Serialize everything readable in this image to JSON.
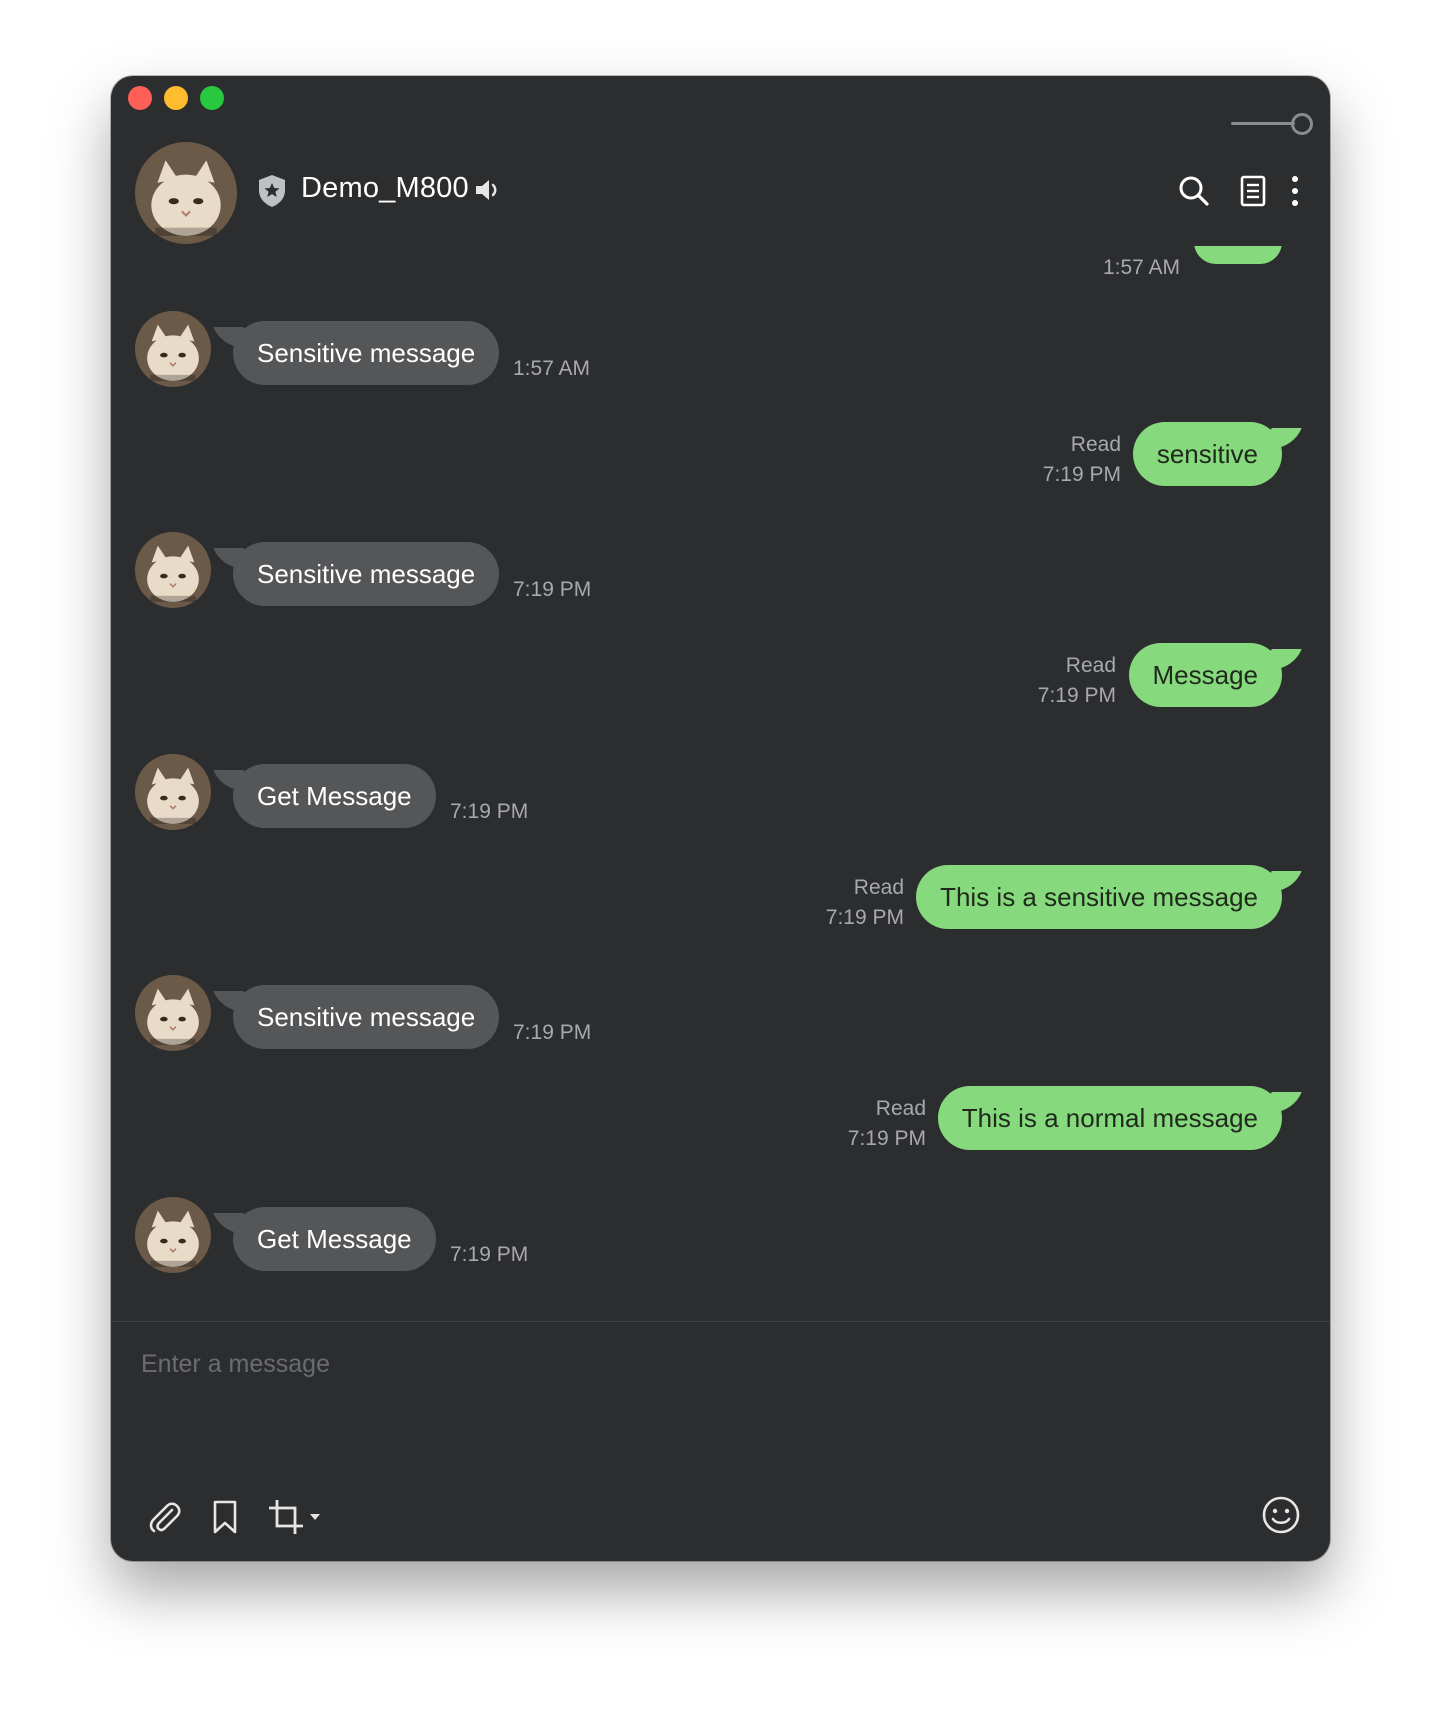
{
  "window": {
    "title": "Demo_M800",
    "traffic_lights": [
      "close",
      "minimize",
      "maximize"
    ],
    "colors": {
      "background": "#2c2d2f",
      "incoming_bubble": "#555658",
      "outgoing_bubble": "#86d97c",
      "meta_text": "#a8a9ab"
    }
  },
  "header": {
    "avatar_icon": "cat-avatar",
    "badge_icon": "shield-star-icon",
    "contact_name": "Demo_M800",
    "sound_icon": "speaker-icon",
    "actions": [
      "search-icon",
      "notes-icon",
      "more-icon"
    ],
    "slider_icon": "slider-toggle"
  },
  "messages": {
    "partial_top": {
      "time": "1:57 AM"
    },
    "items": [
      {
        "direction": "in",
        "text": "Sensitive message",
        "time": "1:57 AM"
      },
      {
        "direction": "out",
        "text": "sensitive",
        "status": "Read",
        "time": "7:19 PM"
      },
      {
        "direction": "in",
        "text": "Sensitive message",
        "time": "7:19 PM"
      },
      {
        "direction": "out",
        "text": "Message",
        "status": "Read",
        "time": "7:19 PM"
      },
      {
        "direction": "in",
        "text": "Get Message",
        "time": "7:19 PM"
      },
      {
        "direction": "out",
        "text": "This is a sensitive message",
        "status": "Read",
        "time": "7:19 PM"
      },
      {
        "direction": "in",
        "text": "Sensitive message",
        "time": "7:19 PM"
      },
      {
        "direction": "out",
        "text": "This is a normal message",
        "status": "Read",
        "time": "7:19 PM"
      },
      {
        "direction": "in",
        "text": "Get Message",
        "time": "7:19 PM"
      }
    ]
  },
  "composer": {
    "placeholder": "Enter a message",
    "value": "",
    "tools": [
      "paperclip-icon",
      "bookmark-icon",
      "crop-icon",
      "emoji-icon"
    ]
  }
}
